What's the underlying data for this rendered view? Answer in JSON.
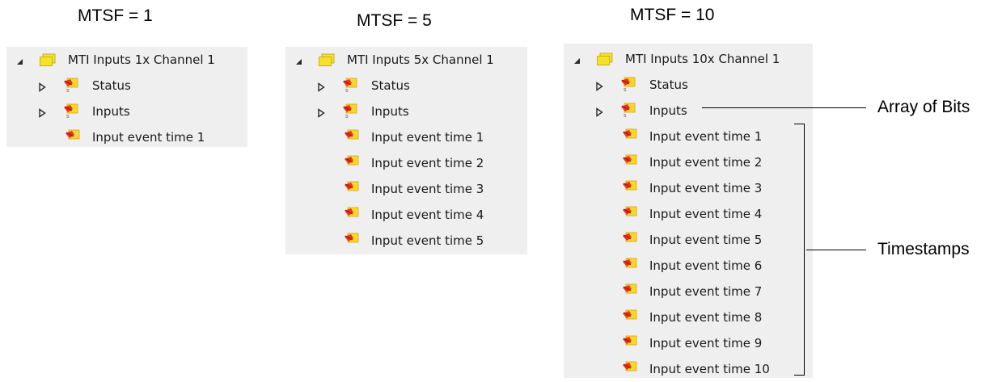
{
  "colors": {
    "panel_bg": "#efefef",
    "folder_yellow": "#f4e12a",
    "var_red": "#e8331c",
    "var_yellow": "#f9d82a"
  },
  "headings": [
    "MTSF = 1",
    "MTSF = 5",
    "MTSF = 10"
  ],
  "trees": [
    {
      "root_label": "MTI Inputs 1x Channel 1",
      "status_label": "Status",
      "inputs_label": "Inputs",
      "events": [
        "Input event time 1"
      ]
    },
    {
      "root_label": "MTI Inputs 5x Channel 1",
      "status_label": "Status",
      "inputs_label": "Inputs",
      "events": [
        "Input event time 1",
        "Input event time 2",
        "Input event time 3",
        "Input event time 4",
        "Input event time 5"
      ]
    },
    {
      "root_label": "MTI Inputs 10x Channel 1",
      "status_label": "Status",
      "inputs_label": "Inputs",
      "events": [
        "Input event time 1",
        "Input event time 2",
        "Input event time 3",
        "Input event time 4",
        "Input event time 5",
        "Input event time 6",
        "Input event time 7",
        "Input event time 8",
        "Input event time 9",
        "Input event time 10"
      ]
    }
  ],
  "annotations": {
    "array_of_bits": "Array of Bits",
    "timestamps": "Timestamps"
  },
  "icons": {
    "expanded": "expanded-triangle-icon",
    "collapsed": "collapsed-triangle-icon",
    "folder": "folder-icon",
    "variable": "input-variable-icon"
  }
}
